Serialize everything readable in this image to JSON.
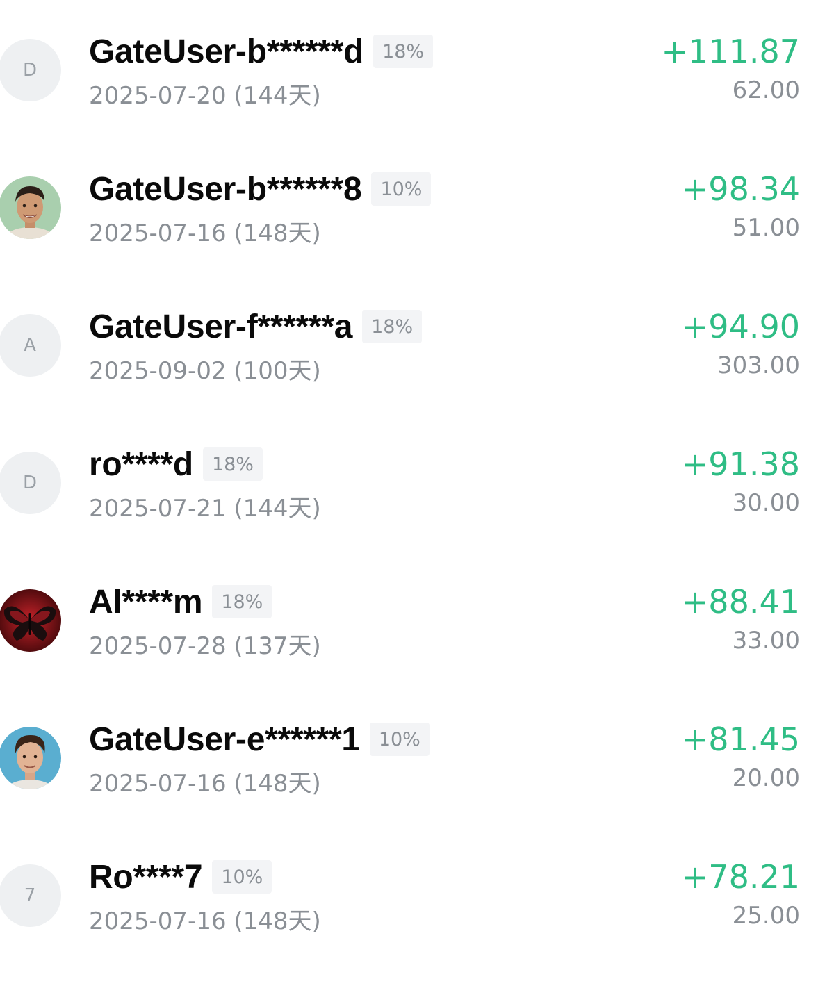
{
  "rows": [
    {
      "avatar_type": "letter",
      "avatar_letter": "D",
      "name": "GateUser-b******d",
      "rate": "18%",
      "date": "2025-07-20 (144天)",
      "profit": "+111.87",
      "amount": "62.00"
    },
    {
      "avatar_type": "photo",
      "avatar_icon": "man-smiling-avatar-icon",
      "name": "GateUser-b******8",
      "rate": "10%",
      "date": "2025-07-16 (148天)",
      "profit": "+98.34",
      "amount": "51.00"
    },
    {
      "avatar_type": "letter",
      "avatar_letter": "A",
      "name": "GateUser-f******a",
      "rate": "18%",
      "date": "2025-09-02 (100天)",
      "profit": "+94.90",
      "amount": "303.00"
    },
    {
      "avatar_type": "letter",
      "avatar_letter": "D",
      "name": "ro****d",
      "rate": "18%",
      "date": "2025-07-21 (144天)",
      "profit": "+91.38",
      "amount": "30.00"
    },
    {
      "avatar_type": "photo",
      "avatar_icon": "red-butterfly-avatar-icon",
      "name": "Al****m",
      "rate": "18%",
      "date": "2025-07-28 (137天)",
      "profit": "+88.41",
      "amount": "33.00"
    },
    {
      "avatar_type": "photo",
      "avatar_icon": "young-man-avatar-icon",
      "name": "GateUser-e******1",
      "rate": "10%",
      "date": "2025-07-16 (148天)",
      "profit": "+81.45",
      "amount": "20.00"
    },
    {
      "avatar_type": "letter",
      "avatar_letter": "7",
      "name": "Ro****7",
      "rate": "10%",
      "date": "2025-07-16 (148天)",
      "profit": "+78.21",
      "amount": "25.00"
    }
  ],
  "colors": {
    "profit": "#2fbd85",
    "secondary_text": "#8a8f95",
    "badge_bg": "#f3f4f6",
    "avatar_bg": "#eef0f2"
  }
}
